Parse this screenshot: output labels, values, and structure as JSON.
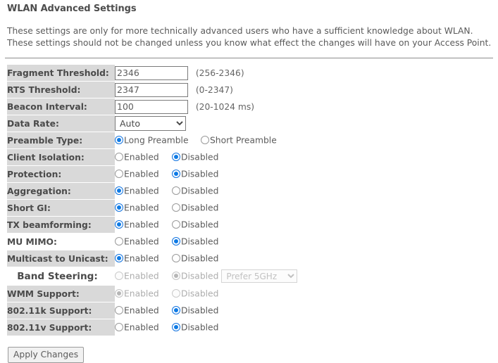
{
  "page": {
    "title": "WLAN Advanced Settings",
    "intro": "These settings are only for more technically advanced users who have a sufficient knowledge about WLAN. These settings should not be changed unless you know what effect the changes will have on your Access Point."
  },
  "fields": {
    "fragment_threshold": {
      "label": "Fragment Threshold:",
      "value": "2346",
      "hint": "(256-2346)"
    },
    "rts_threshold": {
      "label": "RTS Threshold:",
      "value": "2347",
      "hint": "(0-2347)"
    },
    "beacon_interval": {
      "label": "Beacon Interval:",
      "value": "100",
      "hint": "(20-1024 ms)"
    },
    "data_rate": {
      "label": "Data Rate:",
      "value": "Auto"
    },
    "preamble_type": {
      "label": "Preamble Type:",
      "option_long": "Long Preamble",
      "option_short": "Short Preamble"
    },
    "client_isolation": {
      "label": "Client Isolation:"
    },
    "protection": {
      "label": "Protection:"
    },
    "aggregation": {
      "label": "Aggregation:"
    },
    "short_gi": {
      "label": "Short GI:"
    },
    "tx_beamforming": {
      "label": "TX beamforming:"
    },
    "mu_mimo": {
      "label": "MU MIMO:"
    },
    "multicast_to_unicast": {
      "label": "Multicast to Unicast:"
    },
    "band_steering": {
      "label": "Band Steering:",
      "mode": "Prefer 5GHz"
    },
    "wmm_support": {
      "label": "WMM Support:"
    },
    "dot11k_support": {
      "label": "802.11k Support:"
    },
    "dot11v_support": {
      "label": "802.11v Support:"
    }
  },
  "common": {
    "enabled": "Enabled",
    "disabled": "Disabled"
  },
  "actions": {
    "apply": "Apply Changes"
  },
  "colors": {
    "radio_selected": "#0d7ae5",
    "label_bg": "#d9d9d9",
    "text": "#555555"
  }
}
